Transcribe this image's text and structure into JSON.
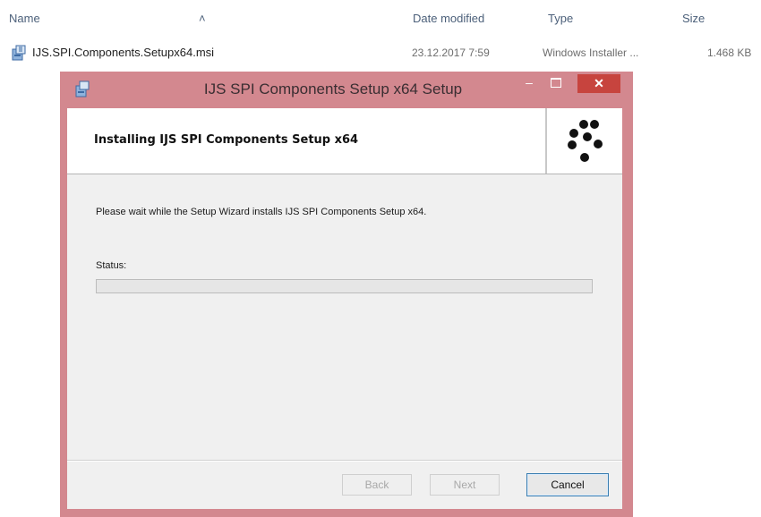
{
  "explorer": {
    "columns": {
      "name": "Name",
      "date": "Date modified",
      "type": "Type",
      "size": "Size"
    },
    "sort_indicator": "˄",
    "file": {
      "name": "IJS.SPI.Components.Setupx64.msi",
      "date": "23.12.2017 7:59",
      "type": "Windows Installer ...",
      "size": "1.468 KB",
      "icon": "msi-installer-icon"
    }
  },
  "dialog": {
    "title": "IJS SPI Components Setup x64 Setup",
    "controls": {
      "minimize": "–",
      "close": "✕"
    },
    "banner_title": "Installing IJS SPI Components Setup x64",
    "description": "Please wait while the Setup Wizard installs IJS SPI Components Setup x64.",
    "status_label": "Status:",
    "progress": 0,
    "buttons": {
      "back": "Back",
      "next": "Next",
      "cancel": "Cancel"
    },
    "colors": {
      "frame": "#d3888f",
      "close": "#c7443e",
      "client": "#f0f0f0"
    }
  }
}
